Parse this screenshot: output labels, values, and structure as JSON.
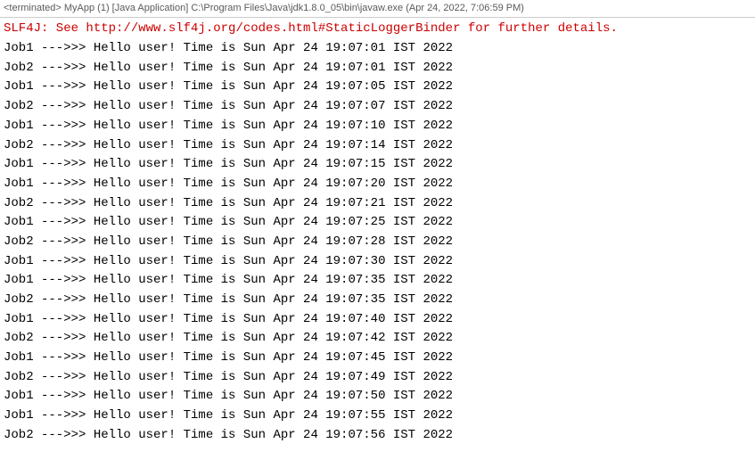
{
  "header": {
    "text": "<terminated> MyApp (1) [Java Application] C:\\Program Files\\Java\\jdk1.8.0_05\\bin\\javaw.exe (Apr 24, 2022, 7:06:59 PM)"
  },
  "console": {
    "slf4j_line": "SLF4J: See http://www.slf4j.org/codes.html#StaticLoggerBinder for further details.",
    "lines": [
      "Job1 --->>> Hello user! Time is Sun Apr 24 19:07:01 IST 2022",
      "Job2 --->>> Hello user! Time is Sun Apr 24 19:07:01 IST 2022",
      "Job1 --->>> Hello user! Time is Sun Apr 24 19:07:05 IST 2022",
      "Job2 --->>> Hello user! Time is Sun Apr 24 19:07:07 IST 2022",
      "Job1 --->>> Hello user! Time is Sun Apr 24 19:07:10 IST 2022",
      "Job2 --->>> Hello user! Time is Sun Apr 24 19:07:14 IST 2022",
      "Job1 --->>> Hello user! Time is Sun Apr 24 19:07:15 IST 2022",
      "Job1 --->>> Hello user! Time is Sun Apr 24 19:07:20 IST 2022",
      "Job2 --->>> Hello user! Time is Sun Apr 24 19:07:21 IST 2022",
      "Job1 --->>> Hello user! Time is Sun Apr 24 19:07:25 IST 2022",
      "Job2 --->>> Hello user! Time is Sun Apr 24 19:07:28 IST 2022",
      "Job1 --->>> Hello user! Time is Sun Apr 24 19:07:30 IST 2022",
      "Job1 --->>> Hello user! Time is Sun Apr 24 19:07:35 IST 2022",
      "Job2 --->>> Hello user! Time is Sun Apr 24 19:07:35 IST 2022",
      "Job1 --->>> Hello user! Time is Sun Apr 24 19:07:40 IST 2022",
      "Job2 --->>> Hello user! Time is Sun Apr 24 19:07:42 IST 2022",
      "Job1 --->>> Hello user! Time is Sun Apr 24 19:07:45 IST 2022",
      "Job2 --->>> Hello user! Time is Sun Apr 24 19:07:49 IST 2022",
      "Job1 --->>> Hello user! Time is Sun Apr 24 19:07:50 IST 2022",
      "Job1 --->>> Hello user! Time is Sun Apr 24 19:07:55 IST 2022",
      "Job2 --->>> Hello user! Time is Sun Apr 24 19:07:56 IST 2022"
    ]
  }
}
